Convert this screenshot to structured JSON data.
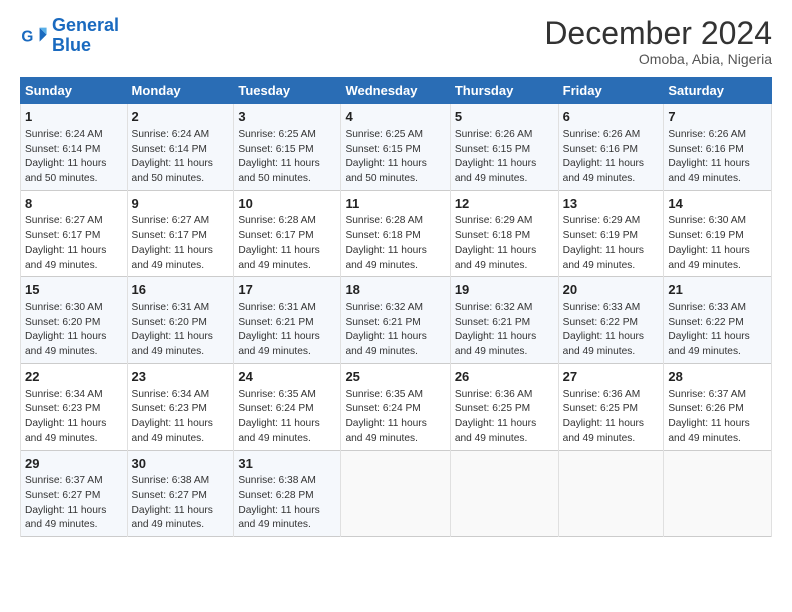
{
  "logo": {
    "line1": "General",
    "line2": "Blue"
  },
  "title": "December 2024",
  "subtitle": "Omoba, Abia, Nigeria",
  "days_of_week": [
    "Sunday",
    "Monday",
    "Tuesday",
    "Wednesday",
    "Thursday",
    "Friday",
    "Saturday"
  ],
  "weeks": [
    [
      {
        "num": "1",
        "sunrise": "6:24 AM",
        "sunset": "6:14 PM",
        "daylight": "11 hours and 50 minutes."
      },
      {
        "num": "2",
        "sunrise": "6:24 AM",
        "sunset": "6:14 PM",
        "daylight": "11 hours and 50 minutes."
      },
      {
        "num": "3",
        "sunrise": "6:25 AM",
        "sunset": "6:15 PM",
        "daylight": "11 hours and 50 minutes."
      },
      {
        "num": "4",
        "sunrise": "6:25 AM",
        "sunset": "6:15 PM",
        "daylight": "11 hours and 50 minutes."
      },
      {
        "num": "5",
        "sunrise": "6:26 AM",
        "sunset": "6:15 PM",
        "daylight": "11 hours and 49 minutes."
      },
      {
        "num": "6",
        "sunrise": "6:26 AM",
        "sunset": "6:16 PM",
        "daylight": "11 hours and 49 minutes."
      },
      {
        "num": "7",
        "sunrise": "6:26 AM",
        "sunset": "6:16 PM",
        "daylight": "11 hours and 49 minutes."
      }
    ],
    [
      {
        "num": "8",
        "sunrise": "6:27 AM",
        "sunset": "6:17 PM",
        "daylight": "11 hours and 49 minutes."
      },
      {
        "num": "9",
        "sunrise": "6:27 AM",
        "sunset": "6:17 PM",
        "daylight": "11 hours and 49 minutes."
      },
      {
        "num": "10",
        "sunrise": "6:28 AM",
        "sunset": "6:17 PM",
        "daylight": "11 hours and 49 minutes."
      },
      {
        "num": "11",
        "sunrise": "6:28 AM",
        "sunset": "6:18 PM",
        "daylight": "11 hours and 49 minutes."
      },
      {
        "num": "12",
        "sunrise": "6:29 AM",
        "sunset": "6:18 PM",
        "daylight": "11 hours and 49 minutes."
      },
      {
        "num": "13",
        "sunrise": "6:29 AM",
        "sunset": "6:19 PM",
        "daylight": "11 hours and 49 minutes."
      },
      {
        "num": "14",
        "sunrise": "6:30 AM",
        "sunset": "6:19 PM",
        "daylight": "11 hours and 49 minutes."
      }
    ],
    [
      {
        "num": "15",
        "sunrise": "6:30 AM",
        "sunset": "6:20 PM",
        "daylight": "11 hours and 49 minutes."
      },
      {
        "num": "16",
        "sunrise": "6:31 AM",
        "sunset": "6:20 PM",
        "daylight": "11 hours and 49 minutes."
      },
      {
        "num": "17",
        "sunrise": "6:31 AM",
        "sunset": "6:21 PM",
        "daylight": "11 hours and 49 minutes."
      },
      {
        "num": "18",
        "sunrise": "6:32 AM",
        "sunset": "6:21 PM",
        "daylight": "11 hours and 49 minutes."
      },
      {
        "num": "19",
        "sunrise": "6:32 AM",
        "sunset": "6:21 PM",
        "daylight": "11 hours and 49 minutes."
      },
      {
        "num": "20",
        "sunrise": "6:33 AM",
        "sunset": "6:22 PM",
        "daylight": "11 hours and 49 minutes."
      },
      {
        "num": "21",
        "sunrise": "6:33 AM",
        "sunset": "6:22 PM",
        "daylight": "11 hours and 49 minutes."
      }
    ],
    [
      {
        "num": "22",
        "sunrise": "6:34 AM",
        "sunset": "6:23 PM",
        "daylight": "11 hours and 49 minutes."
      },
      {
        "num": "23",
        "sunrise": "6:34 AM",
        "sunset": "6:23 PM",
        "daylight": "11 hours and 49 minutes."
      },
      {
        "num": "24",
        "sunrise": "6:35 AM",
        "sunset": "6:24 PM",
        "daylight": "11 hours and 49 minutes."
      },
      {
        "num": "25",
        "sunrise": "6:35 AM",
        "sunset": "6:24 PM",
        "daylight": "11 hours and 49 minutes."
      },
      {
        "num": "26",
        "sunrise": "6:36 AM",
        "sunset": "6:25 PM",
        "daylight": "11 hours and 49 minutes."
      },
      {
        "num": "27",
        "sunrise": "6:36 AM",
        "sunset": "6:25 PM",
        "daylight": "11 hours and 49 minutes."
      },
      {
        "num": "28",
        "sunrise": "6:37 AM",
        "sunset": "6:26 PM",
        "daylight": "11 hours and 49 minutes."
      }
    ],
    [
      {
        "num": "29",
        "sunrise": "6:37 AM",
        "sunset": "6:27 PM",
        "daylight": "11 hours and 49 minutes."
      },
      {
        "num": "30",
        "sunrise": "6:38 AM",
        "sunset": "6:27 PM",
        "daylight": "11 hours and 49 minutes."
      },
      {
        "num": "31",
        "sunrise": "6:38 AM",
        "sunset": "6:28 PM",
        "daylight": "11 hours and 49 minutes."
      },
      null,
      null,
      null,
      null
    ]
  ]
}
